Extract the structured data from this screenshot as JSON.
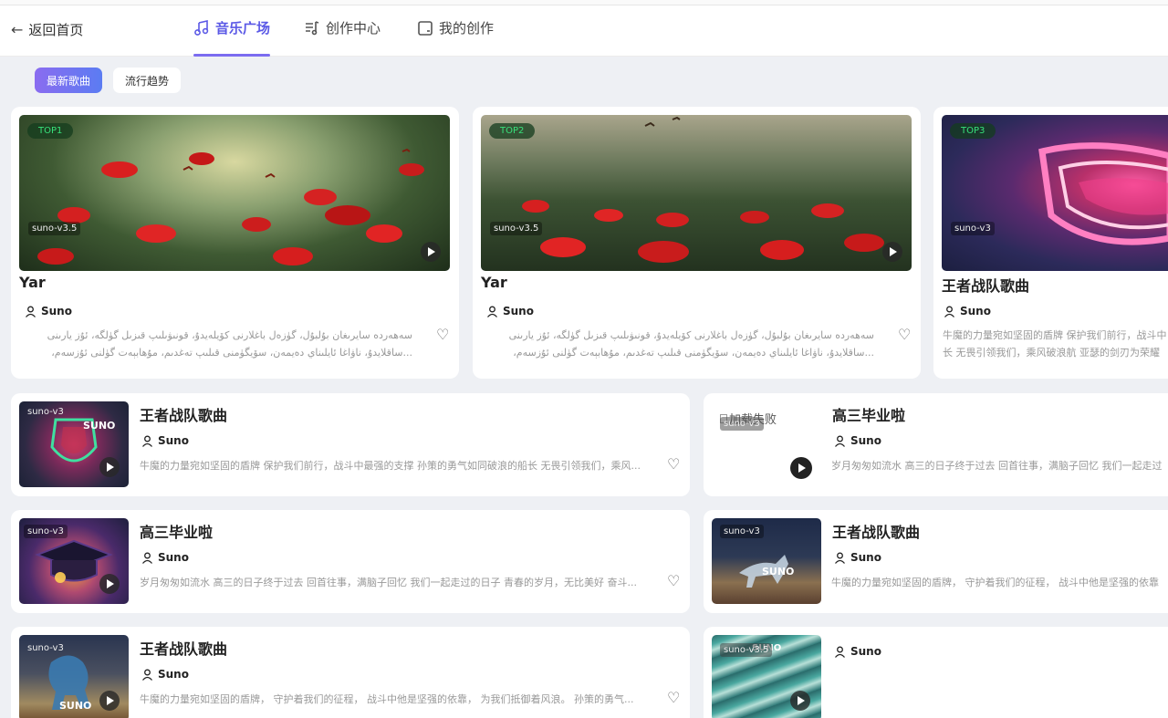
{
  "header": {
    "back_label": "返回首页",
    "tabs": [
      {
        "label": "音乐广场",
        "active": true
      },
      {
        "label": "创作中心",
        "active": false
      },
      {
        "label": "我的创作",
        "active": false
      }
    ]
  },
  "filters": {
    "latest": "最新歌曲",
    "trending": "流行趋势"
  },
  "top_cards": [
    {
      "badge": "TOP1",
      "version": "suno-v3.5",
      "title": "Yar",
      "author": "Suno",
      "desc1": "سەھەردە سايرىغان بۇلبۇل، گۈزەل باغلارنى كۆيلەيدۇ، قونىۋىلىپ قىزىل گۈلگە، ئۇز يارىنى",
      "desc2": "...ساقلايدۇ، ناۋاغا ئايلىناي دەيمەن، سۆيگۈمنى قىلىپ تەغدىم، مۇھابېەت گۈلنى ئۇزسەم،"
    },
    {
      "badge": "TOP2",
      "version": "suno-v3.5",
      "title": "Yar",
      "author": "Suno",
      "desc1": "سەھەردە سايرىغان بۇلبۇل، گۈزەل باغلارنى كۆيلەيدۇ، قونىۋىلىپ قىزىل گۈلگە، ئۇز يارىنى",
      "desc2": "...ساقلايدۇ، ناۋاغا ئايلىناي دەيمەن، سۆيگۈمنى قىلىپ تەغدىم، مۇھابېەت گۈلنى ئۇزسەم،"
    },
    {
      "badge": "TOP3",
      "version": "suno-v3",
      "title": "王者战队歌曲",
      "author": "Suno",
      "desc1": "牛魔的力量宛如坚固的盾牌 保护我们前行，战斗中",
      "desc2": "长 无畏引领我们，乘风破浪航 亚瑟的剑刃为荣耀"
    }
  ],
  "list_cards": [
    {
      "version": "suno-v3",
      "title": "王者战队歌曲",
      "author": "Suno",
      "desc": "牛魔的力量宛如坚固的盾牌 保护我们前行，战斗中最强的支撑 孙策的勇气如同破浪的船长 无畏引领我们，乘风...",
      "cover_text": "SUNO"
    },
    {
      "version": "suno-v3",
      "title": "高三毕业啦",
      "author": "Suno",
      "broken_alt": "加载失败",
      "desc": "岁月匆匆如流水 高三的日子终于过去 回首往事，满脑子回忆 我们一起走过"
    },
    {
      "version": "suno-v3",
      "title": "高三毕业啦",
      "author": "Suno",
      "desc": "岁月匆匆如流水 高三的日子终于过去 回首往事，满脑子回忆 我们一起走过的日子 青春的岁月，无比美好 奋斗..."
    },
    {
      "version": "suno-v3",
      "title": "王者战队歌曲",
      "author": "Suno",
      "desc": "牛魔的力量宛如坚固的盾牌，  守护着我们的征程，  战斗中他是坚强的依靠",
      "cover_text": "SUNO"
    },
    {
      "version": "suno-v3",
      "title": "王者战队歌曲",
      "author": "Suno",
      "desc": "牛魔的力量宛如坚固的盾牌，  守护着我们的征程，  战斗中他是坚强的依靠，  为我们抵御着风浪。 孙策的勇气...",
      "cover_text": "SUNO"
    },
    {
      "version": "suno-v3.5",
      "author": "Suno",
      "cover_text": "SUNO"
    }
  ]
}
